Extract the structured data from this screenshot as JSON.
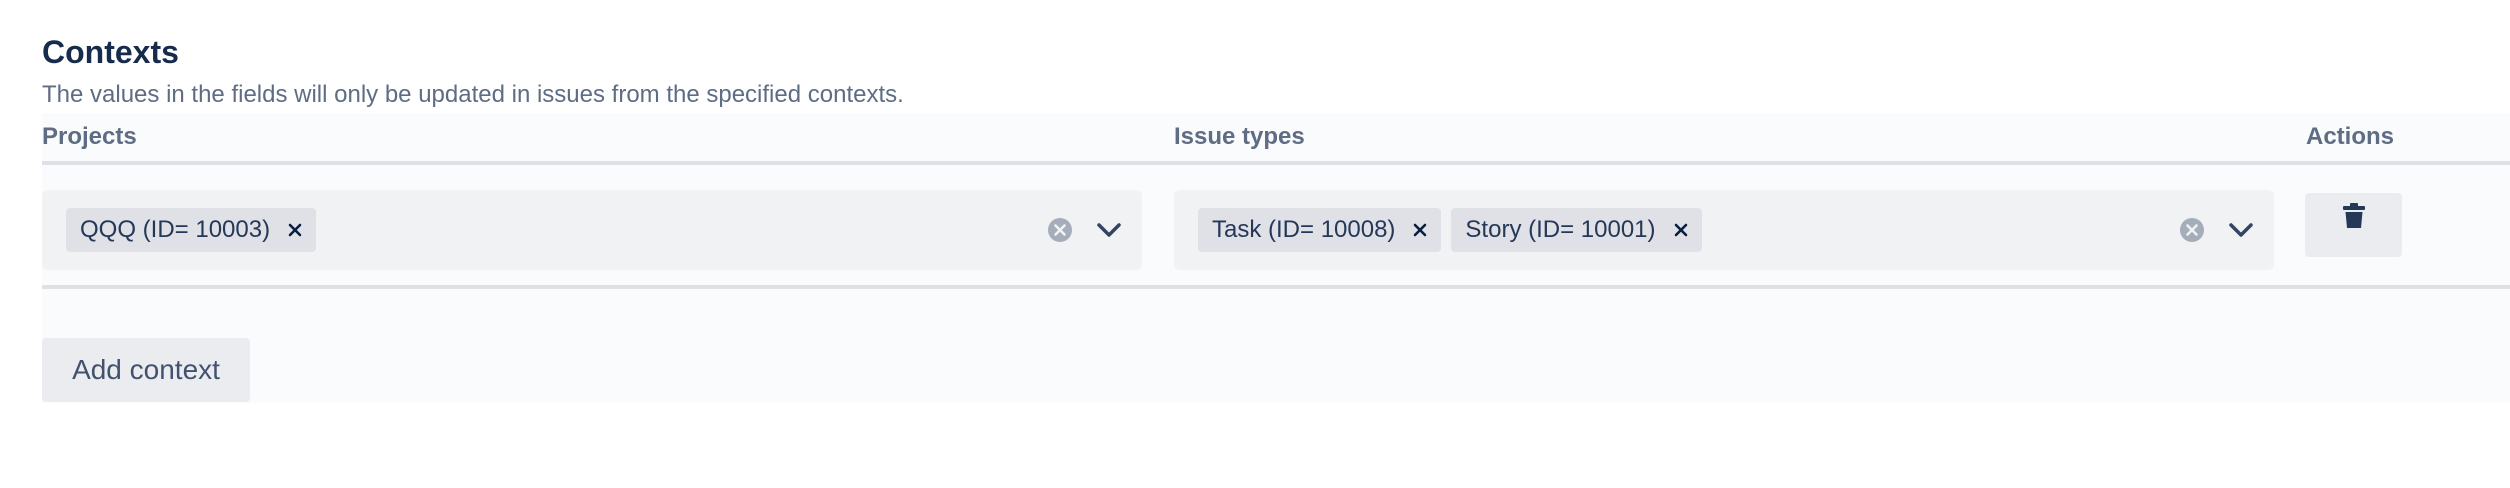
{
  "header": {
    "title": "Contexts",
    "description": "The values in the fields will only be updated in issues from the specified contexts."
  },
  "table": {
    "columns": {
      "projects": "Projects",
      "issue_types": "Issue types",
      "actions": "Actions"
    },
    "rows": [
      {
        "projects": [
          "QQQ (ID= 10003)"
        ],
        "issue_types": [
          "Task (ID= 10008)",
          "Story (ID= 10001)"
        ]
      }
    ]
  },
  "icons": {
    "chip_remove": "close-icon",
    "clear": "clear-circle-icon",
    "dropdown": "chevron-down-icon",
    "delete": "trash-icon"
  },
  "footer": {
    "add_label": "Add context"
  },
  "colors": {
    "heading": "#172b4d",
    "muted": "#5e6c84",
    "select_bg": "#f1f2f4",
    "chip_bg": "#dfe1e6",
    "button_bg": "#ebecf0"
  }
}
